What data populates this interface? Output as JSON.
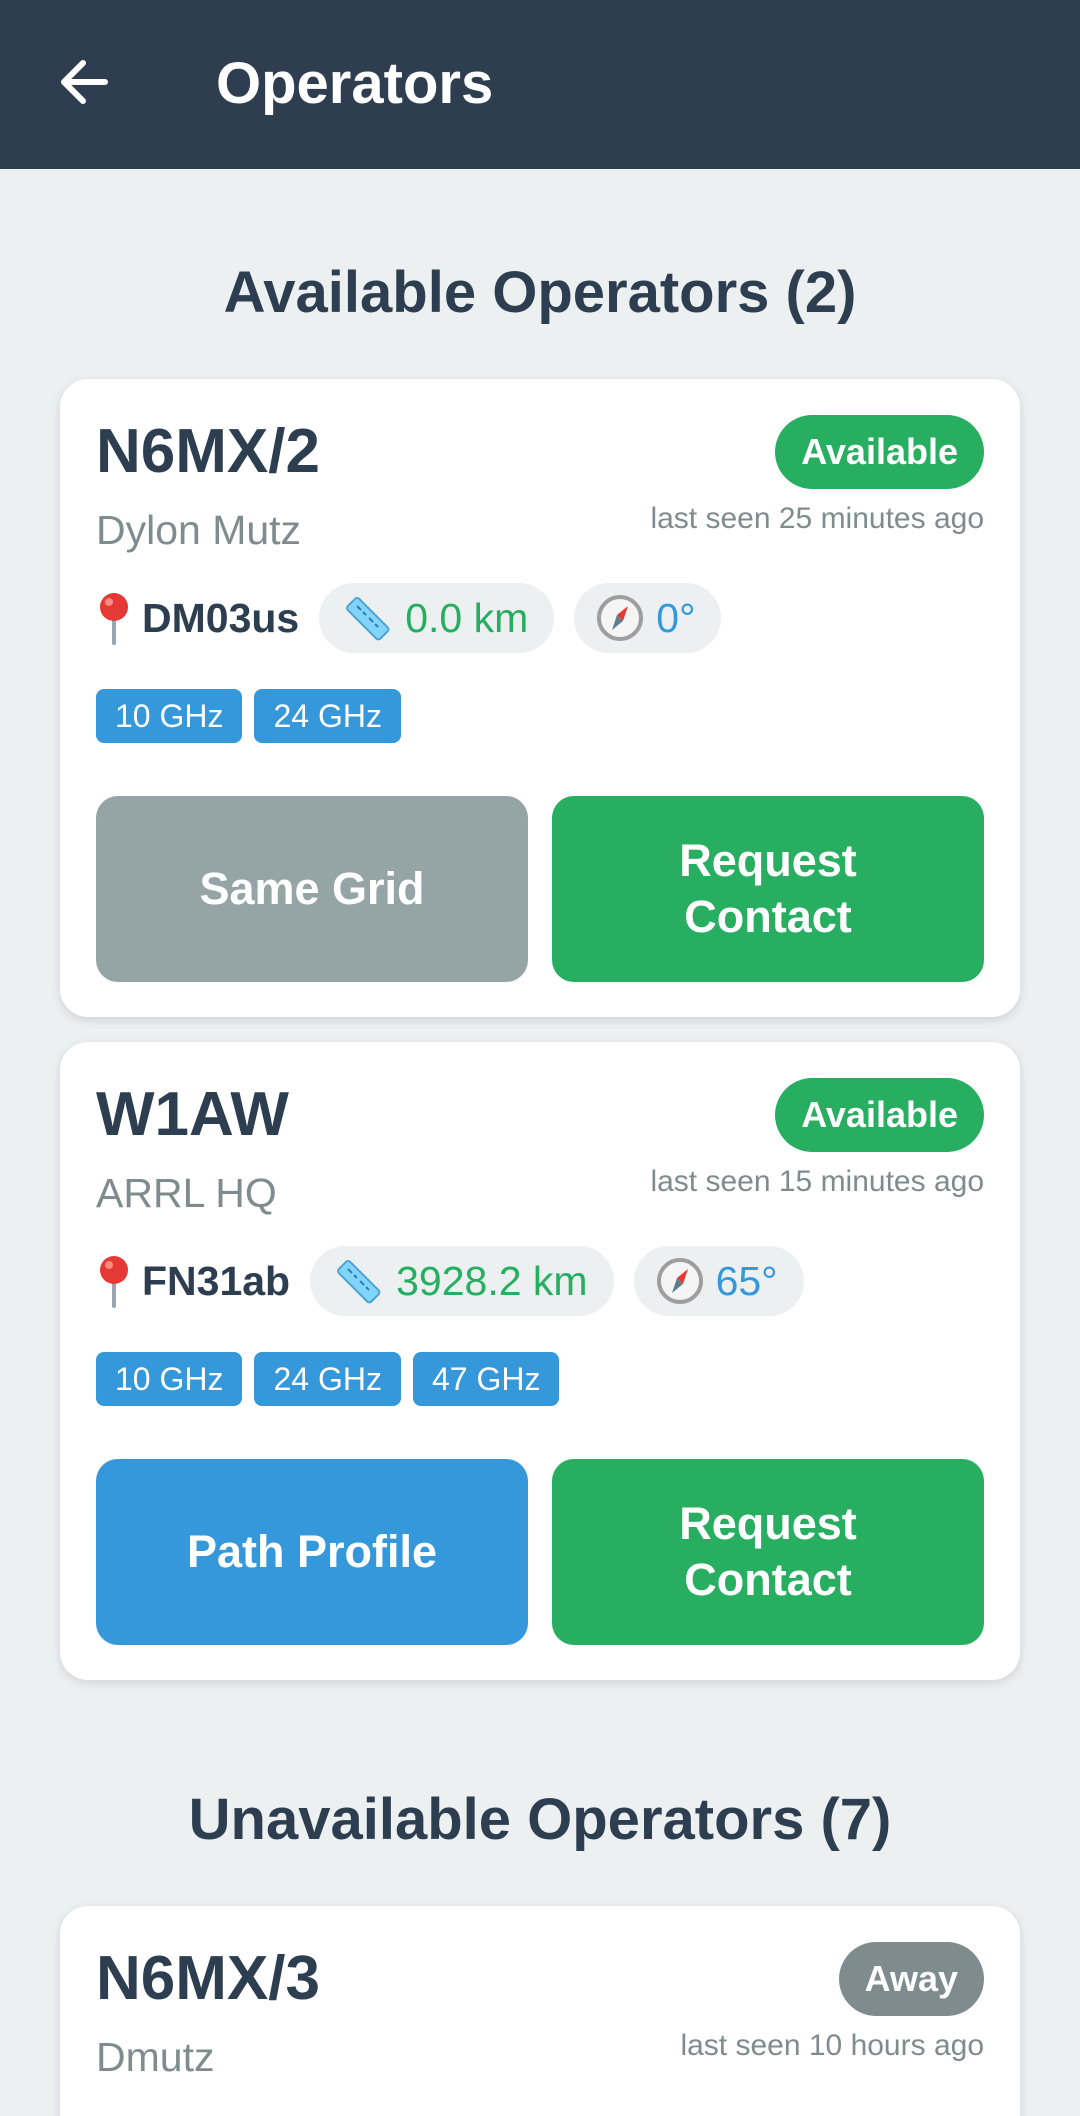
{
  "header": {
    "title": "Operators"
  },
  "sections": {
    "available_title": "Available Operators (2)",
    "unavailable_title": "Unavailable Operators (7)"
  },
  "colors": {
    "appbar": "#2e3d4f",
    "available": "#27ae60",
    "away": "#7f8c8d",
    "band": "#3498db",
    "background": "#ecf0f1"
  },
  "available_operators": [
    {
      "callsign": "N6MX/2",
      "name": "Dylon Mutz",
      "status": "Available",
      "last_seen": "last seen 25 minutes ago",
      "grid": "DM03us",
      "distance": "0.0 km",
      "bearing": "0°",
      "bands": [
        "10 GHz",
        "24 GHz"
      ],
      "secondary_action": "Same Grid",
      "primary_action": "Request Contact"
    },
    {
      "callsign": "W1AW",
      "name": "ARRL HQ",
      "status": "Available",
      "last_seen": "last seen 15 minutes ago",
      "grid": "FN31ab",
      "distance": "3928.2 km",
      "bearing": "65°",
      "bands": [
        "10 GHz",
        "24 GHz",
        "47 GHz"
      ],
      "secondary_action": "Path Profile",
      "primary_action": "Request Contact"
    }
  ],
  "unavailable_operators": [
    {
      "callsign": "N6MX/3",
      "name": "Dmutz",
      "status": "Away",
      "last_seen": "last seen 10 hours ago"
    }
  ],
  "icons": {
    "back": "arrow-left-icon",
    "grid": "map-pin-icon",
    "distance": "ruler-icon",
    "bearing": "compass-icon"
  }
}
